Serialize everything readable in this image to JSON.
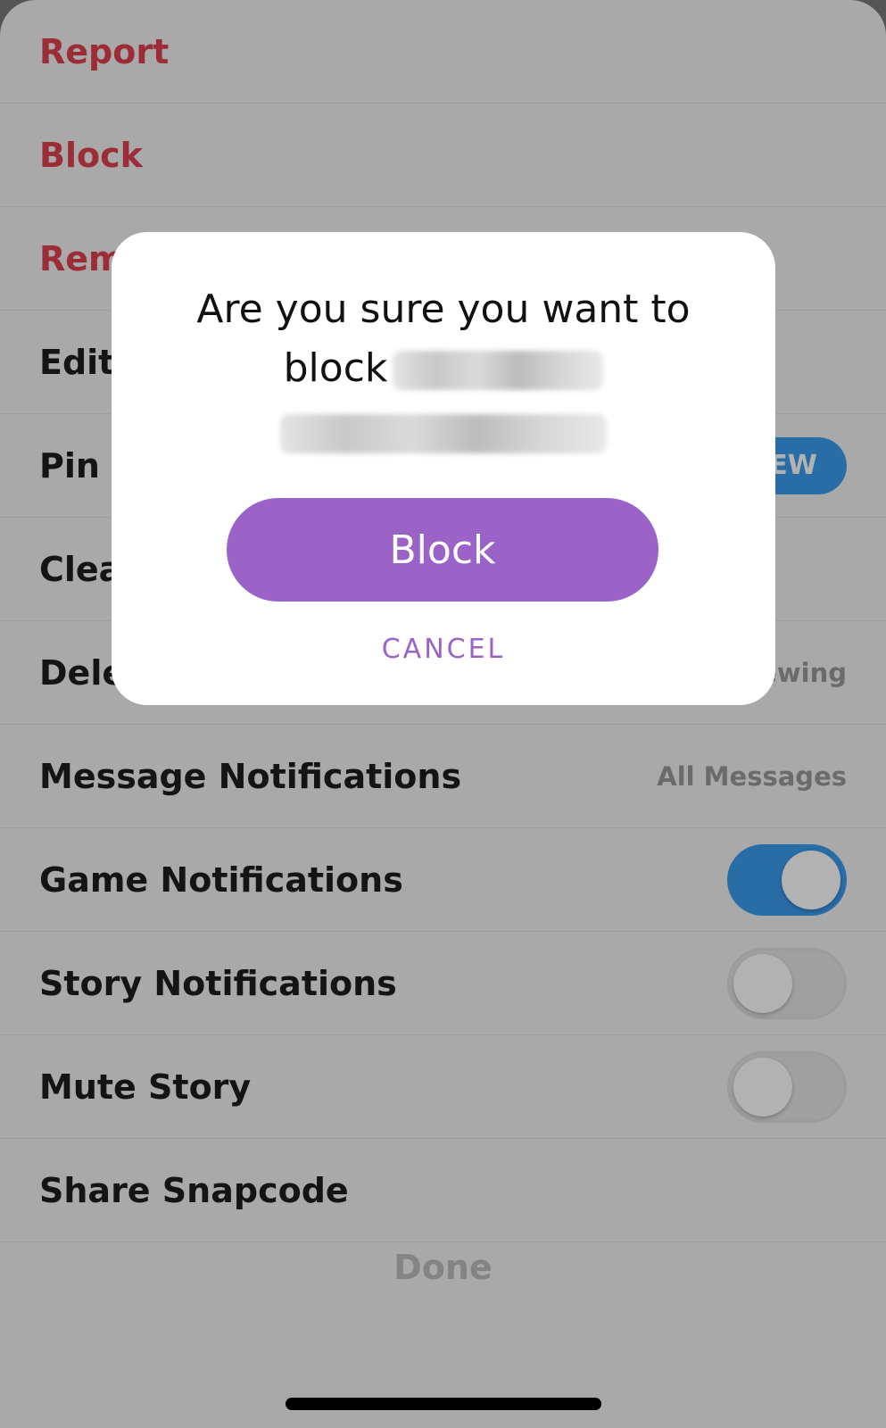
{
  "menu": {
    "items": [
      {
        "label": "Report",
        "style": "danger"
      },
      {
        "label": "Block",
        "style": "danger"
      },
      {
        "label": "Rem",
        "style": "danger"
      },
      {
        "label": "Edit"
      },
      {
        "label": "Pin C",
        "badge": "EW"
      },
      {
        "label": "Clea"
      },
      {
        "label": "Dele",
        "value": "ewing"
      },
      {
        "label": "Message Notifications",
        "value": "All Messages"
      },
      {
        "label": "Game Notifications",
        "toggle": true
      },
      {
        "label": "Story Notifications",
        "toggle": false
      },
      {
        "label": "Mute Story",
        "toggle": false
      },
      {
        "label": "Share Snapcode"
      }
    ],
    "done_label": "Done"
  },
  "dialog": {
    "message_line1": "Are you sure you want to",
    "message_line2": "block",
    "confirm_label": "Block",
    "cancel_label": "CANCEL"
  },
  "colors": {
    "danger": "#e0414f",
    "toggle_on": "#3b9cf0",
    "accent": "#9b62c8"
  }
}
